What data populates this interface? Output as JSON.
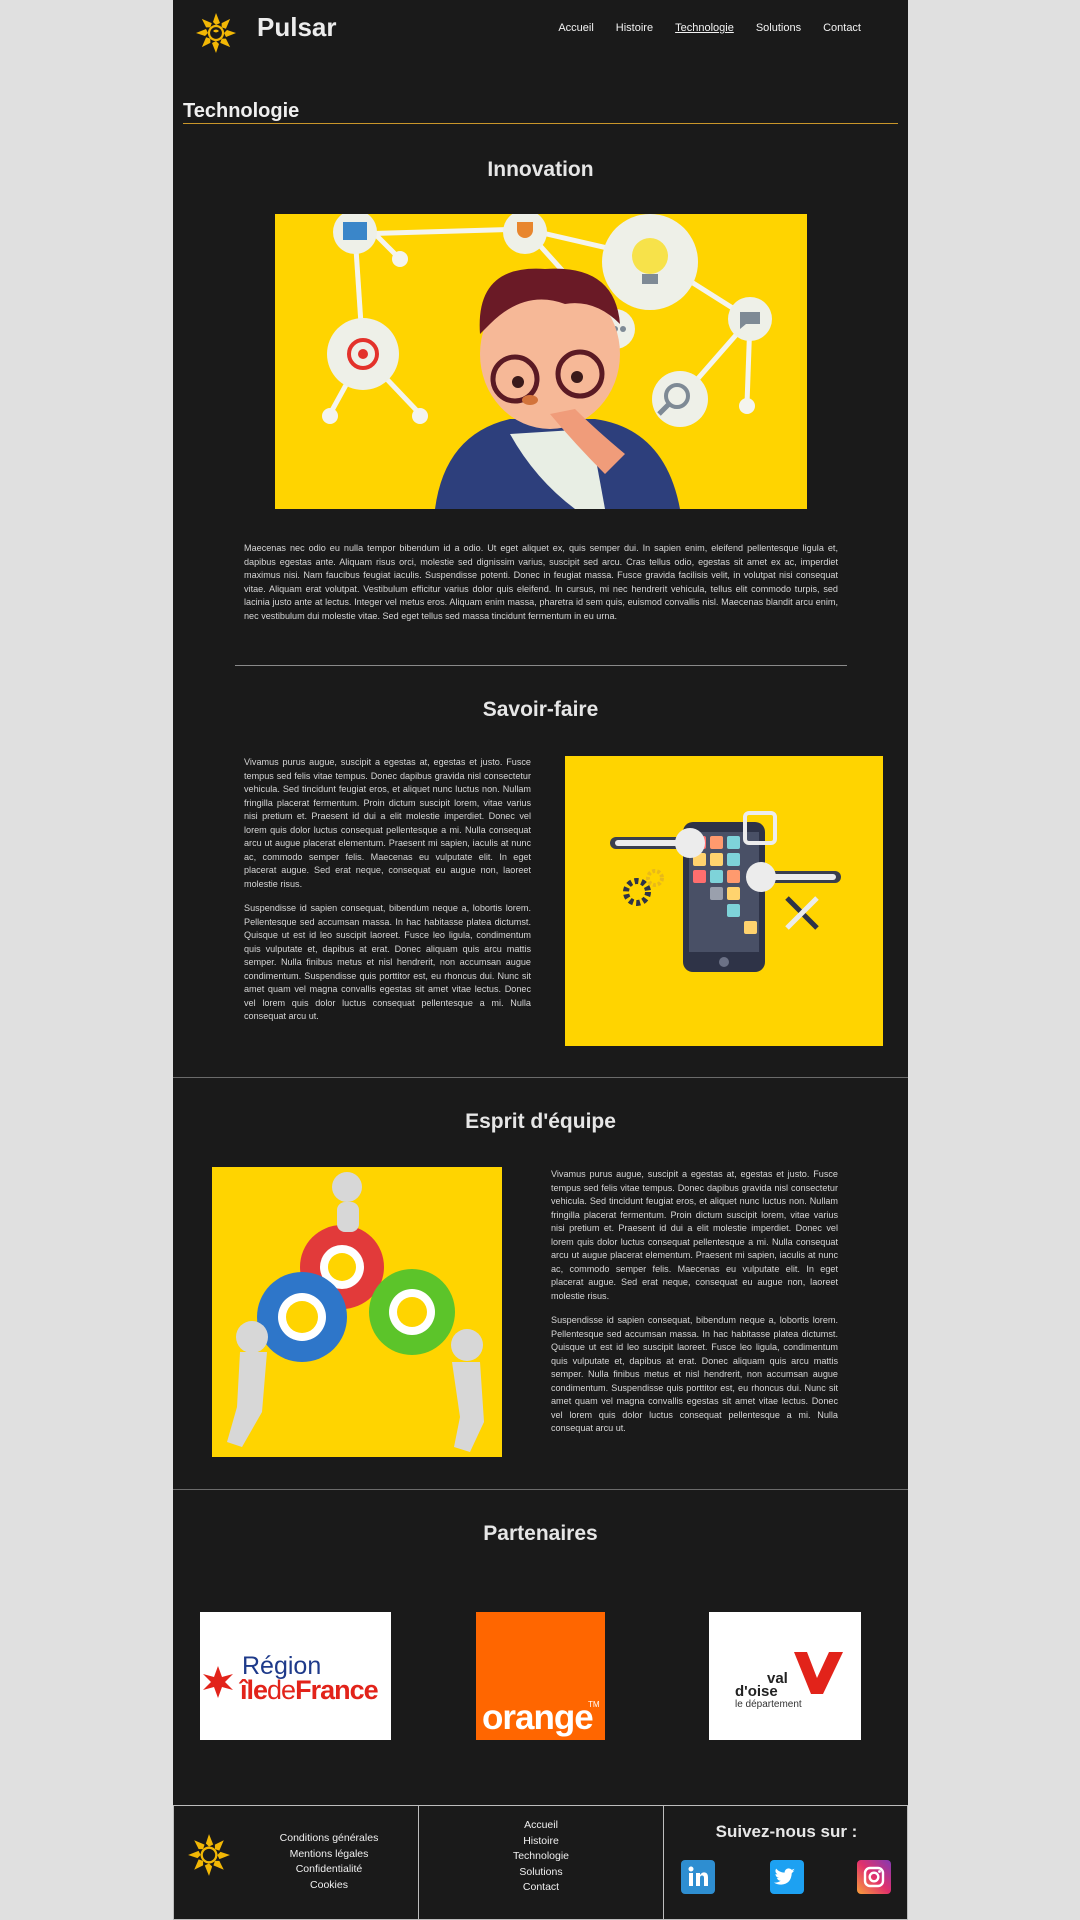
{
  "header": {
    "brand": "Pulsar",
    "nav": [
      "Accueil",
      "Histoire",
      "Technologie",
      "Solutions",
      "Contact"
    ],
    "active_nav": "Technologie"
  },
  "page_title": "Technologie",
  "innovation": {
    "title": "Innovation",
    "text": "Maecenas nec odio eu nulla tempor bibendum id a odio. Ut eget aliquet ex, quis semper dui. In sapien enim, eleifend pellentesque ligula et, dapibus egestas ante. Aliquam risus orci, molestie sed dignissim varius, suscipit sed arcu. Cras tellus odio, egestas sit amet ex ac, imperdiet maximus nisi. Nam faucibus feugiat iaculis. Suspendisse potenti. Donec in feugiat massa. Fusce gravida facilisis velit, in volutpat nisi consequat vitae. Aliquam erat volutpat. Vestibulum efficitur varius dolor quis eleifend. In cursus, mi nec hendrerit vehicula, tellus elit commodo turpis, sed lacinia justo ante at lectus. Integer vel metus eros. Aliquam enim massa, pharetra id sem quis, euismod convallis nisl. Maecenas blandit arcu enim, nec vestibulum dui molestie vitae. Sed eget tellus sed massa tincidunt fermentum in eu urna."
  },
  "savoir_faire": {
    "title": "Savoir-faire",
    "p1": "Vivamus purus augue, suscipit a egestas at, egestas et justo. Fusce tempus sed felis vitae tempus. Donec dapibus gravida nisl consectetur vehicula. Sed tincidunt feugiat eros, et aliquet nunc luctus non. Nullam fringilla placerat fermentum. Proin dictum suscipit lorem, vitae varius nisi pretium et. Praesent id dui a elit molestie imperdiet. Donec vel lorem quis dolor luctus consequat pellentesque a mi. Nulla consequat arcu ut augue placerat elementum. Praesent mi sapien, iaculis at nunc ac, commodo semper felis. Maecenas eu vulputate elit. In eget placerat augue. Sed erat neque, consequat eu augue non, laoreet molestie risus.",
    "p2": "Suspendisse id sapien consequat, bibendum neque a, lobortis lorem. Pellentesque sed accumsan massa. In hac habitasse platea dictumst. Quisque ut est id leo suscipit laoreet. Fusce leo ligula, condimentum quis vulputate et, dapibus at erat. Donec aliquam quis arcu mattis semper. Nulla finibus metus et nisl hendrerit, non accumsan augue condimentum. Suspendisse quis porttitor est, eu rhoncus dui. Nunc sit amet quam vel magna convallis egestas sit amet vitae lectus. Donec vel lorem quis dolor luctus consequat pellentesque a mi. Nulla consequat arcu ut."
  },
  "esprit": {
    "title": "Esprit d'équipe",
    "p1": "Vivamus purus augue, suscipit a egestas at, egestas et justo. Fusce tempus sed felis vitae tempus. Donec dapibus gravida nisl consectetur vehicula. Sed tincidunt feugiat eros, et aliquet nunc luctus non. Nullam fringilla placerat fermentum. Proin dictum suscipit lorem, vitae varius nisi pretium et. Praesent id dui a elit molestie imperdiet. Donec vel lorem quis dolor luctus consequat pellentesque a mi. Nulla consequat arcu ut augue placerat elementum. Praesent mi sapien, iaculis at nunc ac, commodo semper felis. Maecenas eu vulputate elit. In eget placerat augue. Sed erat neque, consequat eu augue non, laoreet molestie risus.",
    "p2": "Suspendisse id sapien consequat, bibendum neque a, lobortis lorem. Pellentesque sed accumsan massa. In hac habitasse platea dictumst. Quisque ut est id leo suscipit laoreet. Fusce leo ligula, condimentum quis vulputate et, dapibus at erat. Donec aliquam quis arcu mattis semper. Nulla finibus metus et nisl hendrerit, non accumsan augue condimentum. Suspendisse quis porttitor est, eu rhoncus dui. Nunc sit amet quam vel magna convallis egestas sit amet vitae lectus. Donec vel lorem quis dolor luctus consequat pellentesque a mi. Nulla consequat arcu ut."
  },
  "partners": {
    "title": "Partenaires",
    "logos": [
      {
        "name": "region-ile-de-france",
        "line1": "Région",
        "line2a": "île",
        "line2b": "de",
        "line2c": "France"
      },
      {
        "name": "orange",
        "text": "orange",
        "tm": "TM"
      },
      {
        "name": "val-doise",
        "line1": "val",
        "line2": "d'oise",
        "line3": "le département"
      }
    ]
  },
  "footer": {
    "legal": [
      "Conditions générales",
      "Mentions légales",
      "Confidentialité",
      "Cookies"
    ],
    "nav": [
      "Accueil",
      "Histoire",
      "Technologie",
      "Solutions",
      "Contact"
    ],
    "follow": "Suivez-nous sur :",
    "social": [
      "linkedin-icon",
      "twitter-icon",
      "instagram-icon"
    ]
  },
  "colors": {
    "page_bg": "#1a1a1a",
    "outer_bg": "#e0e0e0",
    "accent_yellow": "#ffd400",
    "title_rule": "#c9962a",
    "orange_brand": "#ff6600"
  }
}
